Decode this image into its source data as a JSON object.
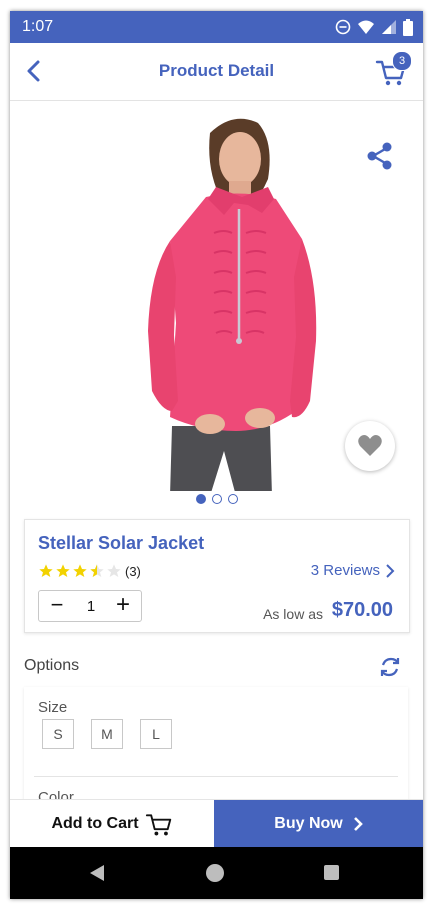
{
  "statusbar": {
    "time": "1:07"
  },
  "appbar": {
    "title": "Product Detail",
    "cart_count": "3"
  },
  "hero": {
    "image_alt": "Model wearing a pink Stellar Solar Jacket",
    "slide_count": 3,
    "active_slide": 1
  },
  "product": {
    "name": "Stellar Solar Jacket",
    "rating": 3.5,
    "rating_max": 5,
    "rating_count": "(3)",
    "reviews_link": "3 Reviews",
    "quantity": "1",
    "price_prefix": "As low as",
    "price": "$70.00"
  },
  "options": {
    "heading": "Options",
    "size_label": "Size",
    "sizes": [
      "S",
      "M",
      "L"
    ],
    "color_label": "Color"
  },
  "actions": {
    "add_to_cart": "Add to Cart",
    "buy_now": "Buy Now"
  },
  "theme": {
    "primary": "#4563bd",
    "star": "#f2d200",
    "jacket": "#ee4a78"
  }
}
